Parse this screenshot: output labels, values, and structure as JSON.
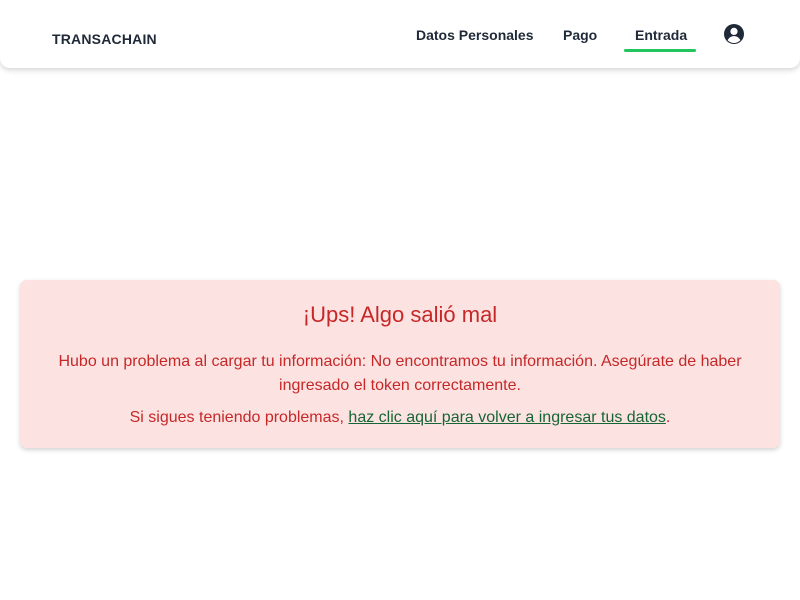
{
  "header": {
    "brand": "TRANSACHAIN",
    "nav": [
      {
        "label": "Datos Personales"
      },
      {
        "label": "Pago"
      },
      {
        "label": "Entrada",
        "active": true
      }
    ],
    "profile_icon": "user-circle-icon"
  },
  "error": {
    "title": "¡Ups! Algo salió mal",
    "message": "Hubo un problema al cargar tu información: No encontramos tu información. Asegúrate de haber ingresado el token correctamente.",
    "help_prefix": "Si sigues teniendo problemas, ",
    "help_link": "haz clic aquí para volver a ingresar tus datos",
    "help_suffix": "."
  },
  "colors": {
    "accent_green": "#22c55e",
    "error_bg": "#fde2e2",
    "error_text": "#c62828",
    "link_green": "#166534",
    "nav_text": "#1f2937"
  }
}
